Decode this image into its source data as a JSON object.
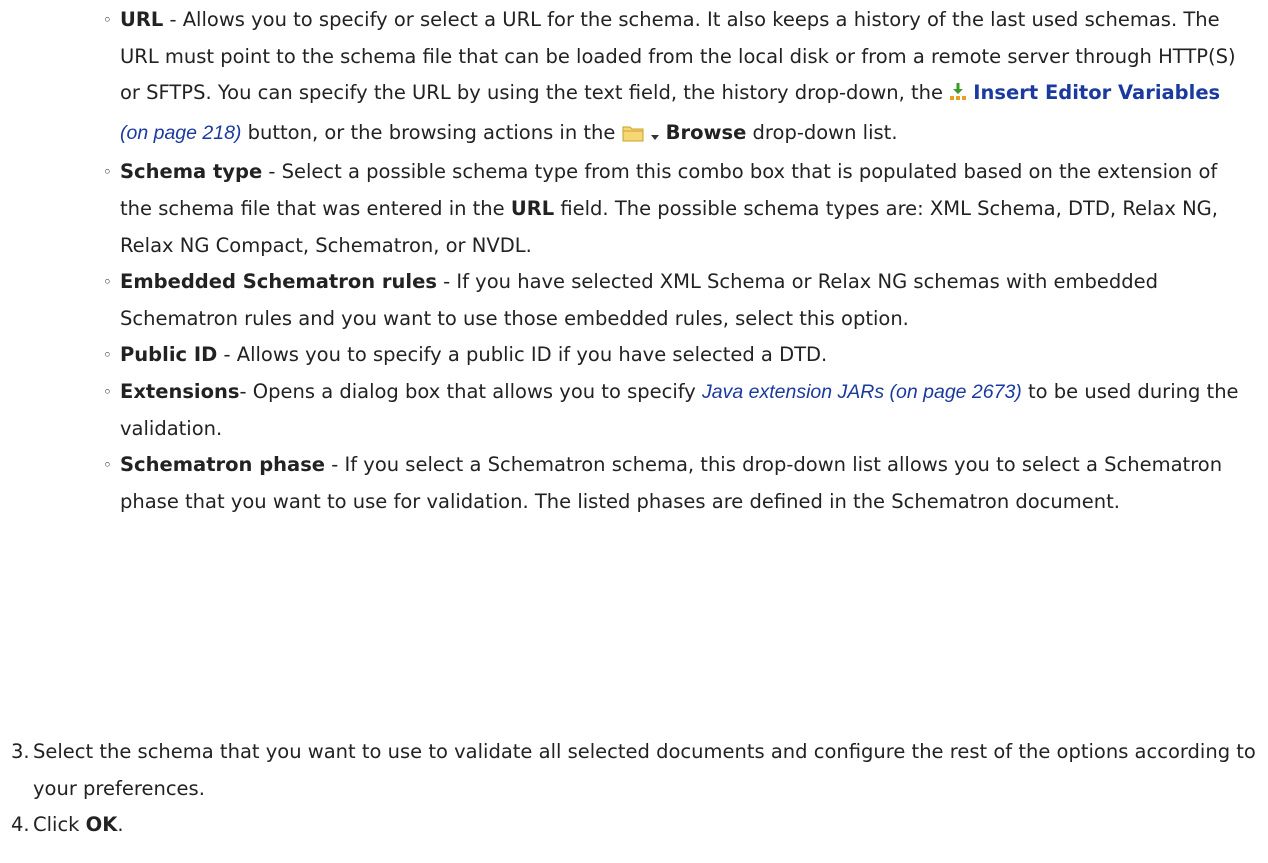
{
  "options": {
    "url": {
      "term": "URL",
      "text_1": " - Allows you to specify or select a URL for the schema. It also keeps a history of the last used schemas. The URL must point to the schema file that can be loaded from the local disk or from a remote server through HTTP(S) or SFTPS. You can specify the URL by using the text field, the history drop-down, the ",
      "insert_link": "Insert Editor Variables",
      "insert_ref": "(on page 218)",
      "text_2": " button, or the browsing actions in the ",
      "browse_label": "Browse",
      "text_3": " drop-down list."
    },
    "schema_type": {
      "term": "Schema type",
      "text_1": " - Select a possible schema type from this combo box that is populated based on the extension of the schema file that was entered in the ",
      "url_term": "URL",
      "text_2": " field. The possible schema types are: XML Schema, DTD, Relax NG, Relax NG Compact, Schematron, or NVDL."
    },
    "embedded": {
      "term": "Embedded Schematron rules",
      "text": " - If you have selected XML Schema or Relax NG schemas with embedded Schematron rules and you want to use those embedded rules, select this option."
    },
    "public_id": {
      "term": "Public ID",
      "text": " - Allows you to specify a public ID if you have selected a DTD."
    },
    "extensions": {
      "term": "Extensions",
      "text_1": "- Opens a dialog box that allows you to specify ",
      "ref": "Java extension JARs (on page 2673)",
      "text_2": " to be used during the validation."
    },
    "phase": {
      "term": "Schematron phase",
      "text": " - If you select a Schematron schema, this drop-down list allows you to select a Schematron phase that you want to use for validation. The listed phases are defined in the Schematron document."
    }
  },
  "steps": {
    "step3": {
      "number": "3.",
      "text": "Select the schema that you want to use to validate all selected documents and configure the rest of the options according to your preferences."
    },
    "step4": {
      "number": "4.",
      "text_1": "Click ",
      "ok": "OK",
      "text_2": "."
    }
  },
  "icons": {
    "insert_variables": "insert-editor-variables-icon",
    "folder": "folder-icon",
    "dropdown_arrow": "dropdown-arrow-icon",
    "link_color": "#1a3a9e",
    "folder_color": "#f2c94c"
  }
}
